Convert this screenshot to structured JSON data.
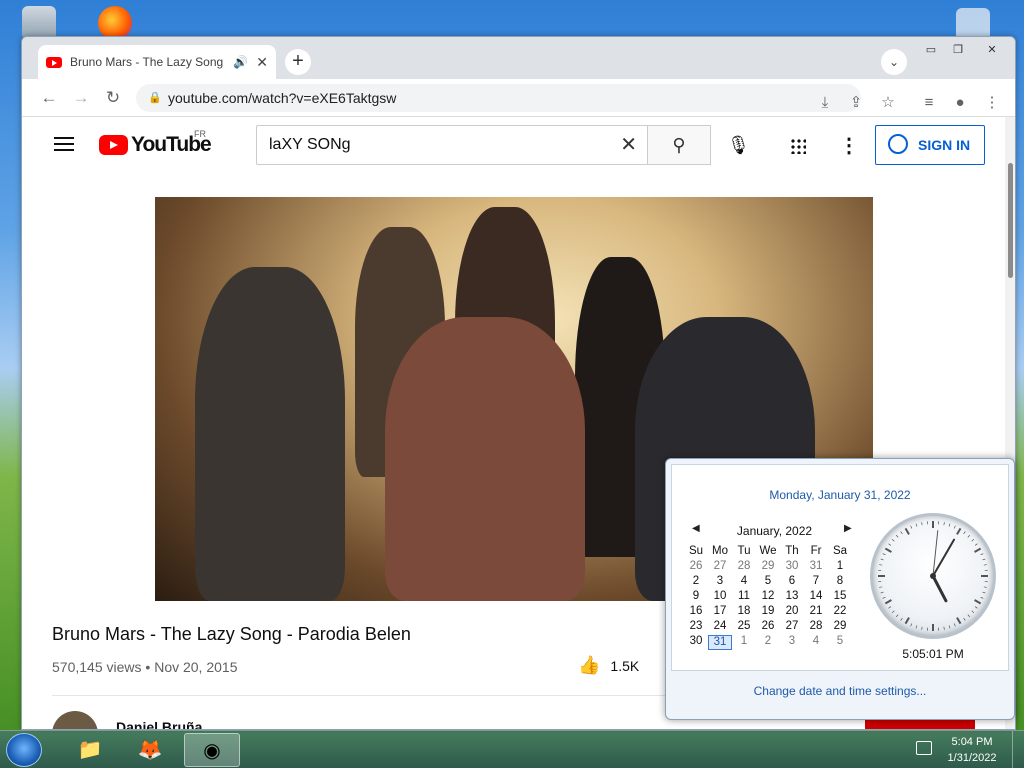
{
  "browser": {
    "tab_title": "Bruno Mars - The Lazy Song",
    "new_tab_label": "+",
    "url": "youtube.com/watch?v=eXE6Taktgsw"
  },
  "youtube": {
    "logo_text": "YouTube",
    "country_code": "FR",
    "search_value": "laXY SONg",
    "sign_in_label": "SIGN IN",
    "video_title": "Bruno Mars - The Lazy Song - Parodia Belen",
    "views": "570,145 views",
    "date": "Nov 20, 2015",
    "likes": "1.5K",
    "channel_name": "Daniel Bruña"
  },
  "calendar": {
    "full_date": "Monday, January 31, 2022",
    "month_label": "January, 2022",
    "weekdays": [
      "Su",
      "Mo",
      "Tu",
      "We",
      "Th",
      "Fr",
      "Sa"
    ],
    "weeks": [
      [
        "26",
        "27",
        "28",
        "29",
        "30",
        "31",
        "1"
      ],
      [
        "2",
        "3",
        "4",
        "5",
        "6",
        "7",
        "8"
      ],
      [
        "9",
        "10",
        "11",
        "12",
        "13",
        "14",
        "15"
      ],
      [
        "16",
        "17",
        "18",
        "19",
        "20",
        "21",
        "22"
      ],
      [
        "23",
        "24",
        "25",
        "26",
        "27",
        "28",
        "29"
      ],
      [
        "30",
        "31",
        "1",
        "2",
        "3",
        "4",
        "5"
      ]
    ],
    "today": "31",
    "clock_time": "5:05:01 PM",
    "clock_hands": {
      "hour": 17,
      "minute": 5,
      "second": 1
    },
    "settings_link": "Change date and time settings..."
  },
  "taskbar": {
    "time": "5:04 PM",
    "date": "1/31/2022"
  },
  "colors": {
    "youtube_red": "#ff0000",
    "link_blue": "#065fd4",
    "calendar_blue": "#1e5aa8"
  }
}
